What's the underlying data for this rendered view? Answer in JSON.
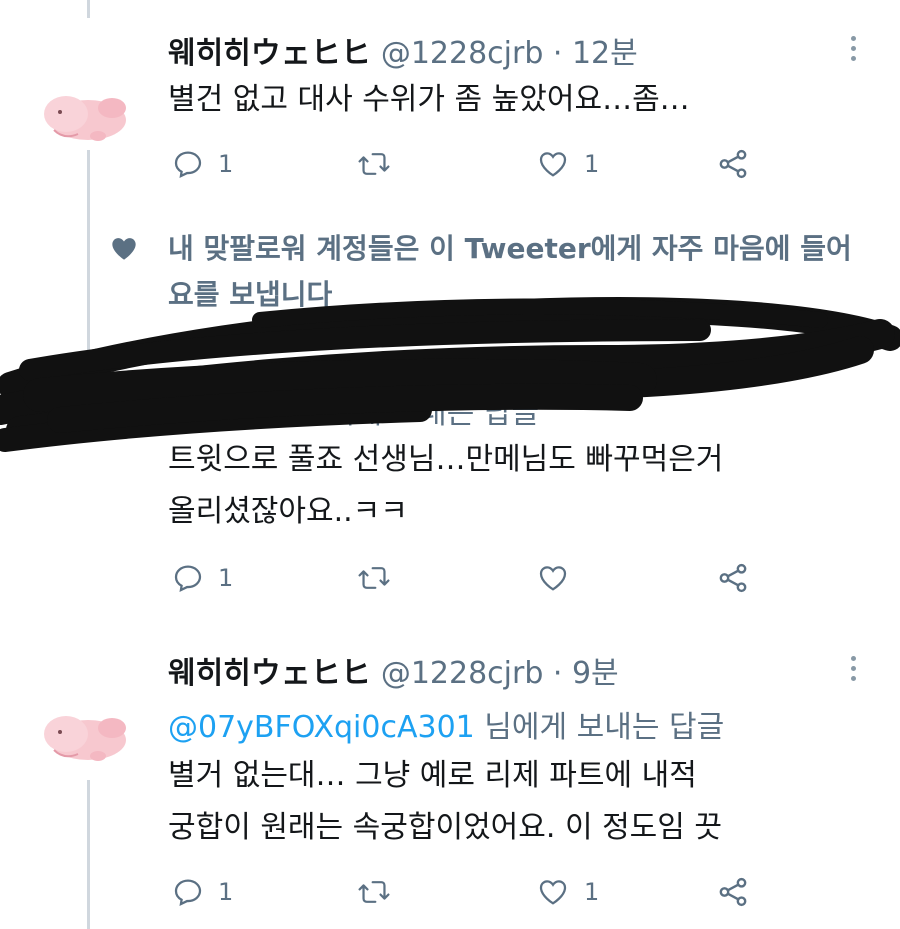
{
  "colors": {
    "text": "#14171a",
    "secondary": "#5b7083",
    "link": "#1da1f2",
    "thread": "#d0d7de"
  },
  "tweets": [
    {
      "name": "웨히히ウェヒヒ",
      "handle": "@1228cjrb · 12분",
      "lines": [
        "별건 없고 대사 수위가 좀 높았어요…좀…"
      ],
      "reply_count": "1",
      "like_count": "1"
    },
    {
      "social_context": "내 맞팔로워 계정들은 이 Tweeter에게 자주 마음에 들어요를 보냅니다",
      "reply_to_visible": "jrb 님에게 보내는 답글",
      "lines": [
        "트윗으로 풀죠 선생님…만메님도 빠꾸먹은거",
        "올리셨잖아요..ㅋㅋ"
      ],
      "reply_count": "1",
      "like_count": ""
    },
    {
      "name": "웨히히ウェヒヒ",
      "handle": "@1228cjrb · 9분",
      "reply_mention": "@07yBFOXqi0cA301",
      "reply_suffix": " 님에게 보내는 답글",
      "lines": [
        "별거 없는대… 그냥 예로 리제 파트에 내적",
        "궁합이 원래는 속궁합이었어요. 이 정도임 끗"
      ],
      "reply_count": "1",
      "like_count": "1"
    }
  ],
  "icons": [
    "reply-icon",
    "retweet-icon",
    "like-icon",
    "share-icon",
    "more-icon",
    "heart-icon"
  ]
}
